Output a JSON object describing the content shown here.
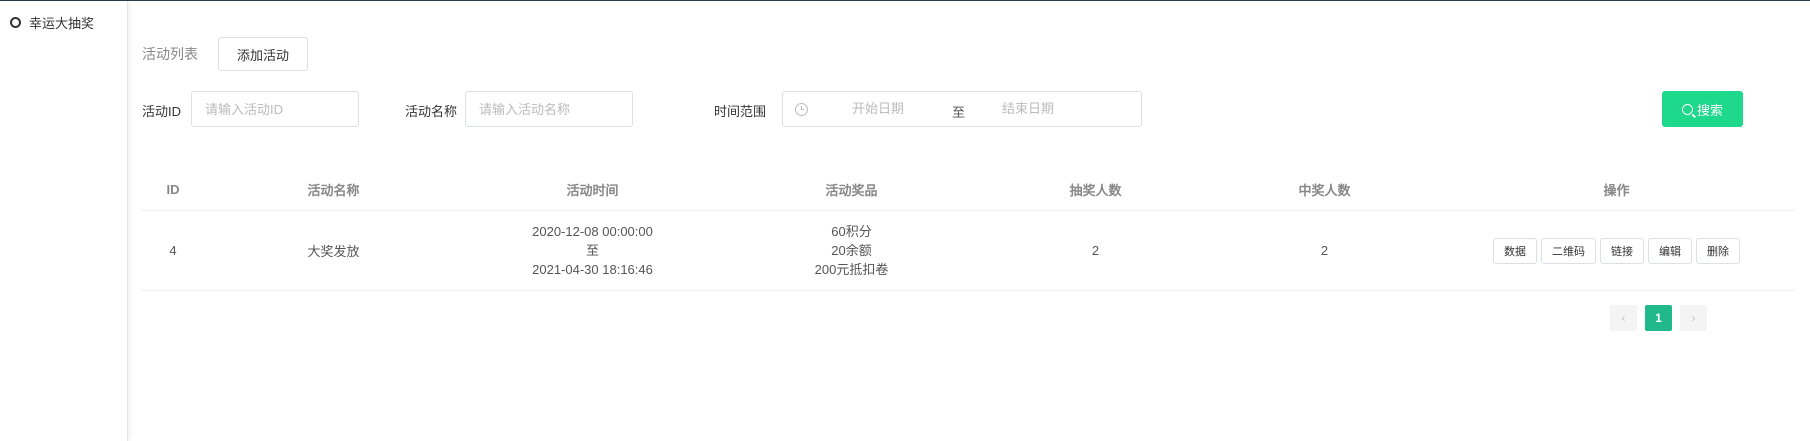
{
  "sidebar": {
    "items": [
      {
        "label": "幸运大抽奖"
      }
    ]
  },
  "header": {
    "title": "活动列表",
    "add_label": "添加活动"
  },
  "filters": {
    "id_label": "活动ID",
    "id_placeholder": "请输入活动ID",
    "name_label": "活动名称",
    "name_placeholder": "请输入活动名称",
    "time_label": "时间范围",
    "start_placeholder": "开始日期",
    "range_separator": "至",
    "end_placeholder": "结束日期",
    "search_label": "搜索"
  },
  "table": {
    "columns": [
      "ID",
      "活动名称",
      "活动时间",
      "活动奖品",
      "抽奖人数",
      "中奖人数",
      "操作"
    ],
    "rows": [
      {
        "id": "4",
        "name": "大奖发放",
        "time_start": "2020-12-08 00:00:00",
        "time_sep": "至",
        "time_end": "2021-04-30 18:16:46",
        "prizes": [
          "60积分",
          "20余额",
          "200元抵扣卷"
        ],
        "draw_count": "2",
        "win_count": "2",
        "actions": [
          "数据",
          "二维码",
          "链接",
          "编辑",
          "删除"
        ]
      }
    ]
  },
  "pagination": {
    "prev": "‹",
    "current": "1",
    "next": "›"
  },
  "colors": {
    "accent": "#1ed88b",
    "page_active": "#21b98b"
  }
}
